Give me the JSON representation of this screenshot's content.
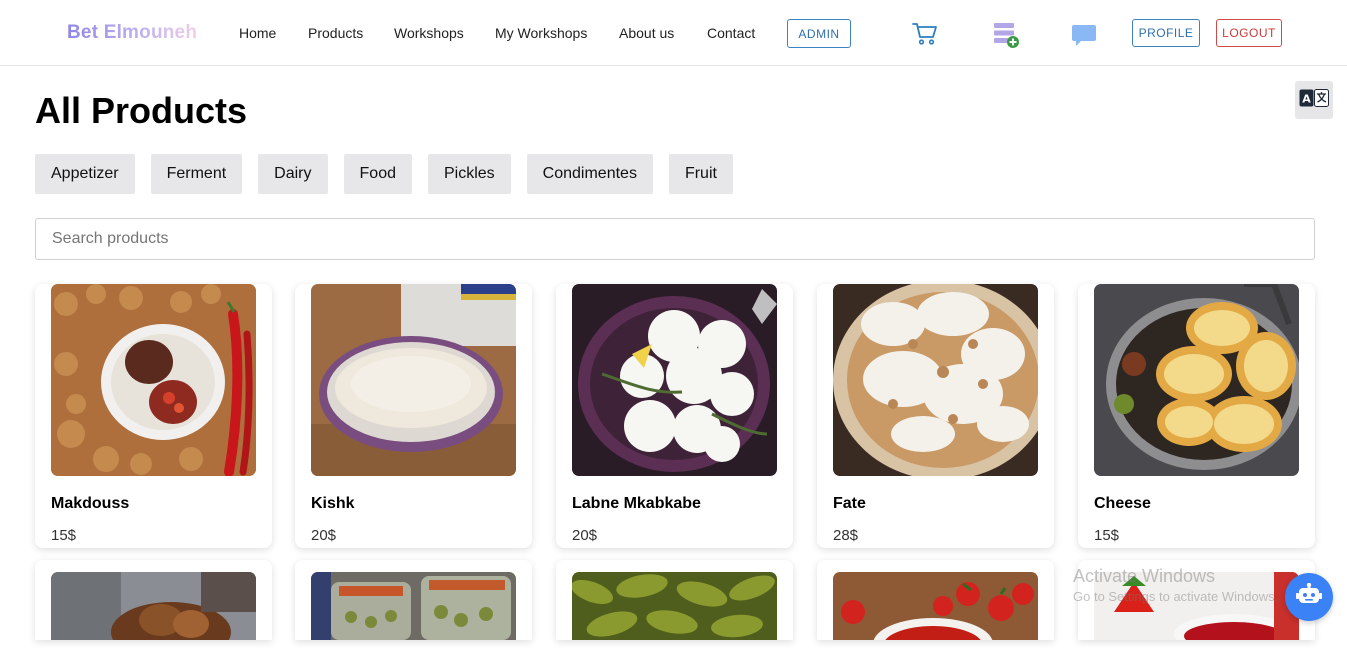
{
  "app": {
    "brand": "Bet Elmouneh"
  },
  "nav": {
    "home": "Home",
    "products": "Products",
    "workshops": "Workshops",
    "my_workshops": "My Workshops",
    "about": "About us",
    "contact": "Contact",
    "admin": "ADMIN",
    "profile": "PROFILE",
    "logout": "LOGOUT"
  },
  "icons": {
    "cart": "cart-icon",
    "add_list": "add-list-icon",
    "chat": "chat-bubble-icon",
    "translate": "translate-icon",
    "chatbot": "chatbot-icon"
  },
  "colors": {
    "accent_blue": "#3f82c0",
    "logout_red": "#d04a4a",
    "category_bg": "#e7e7ea",
    "chatbot_blue": "#3b82f6"
  },
  "page": {
    "title": "All Products"
  },
  "categories": [
    "Appetizer",
    "Ferment",
    "Dairy",
    "Food",
    "Pickles",
    "Condimentes",
    "Fruit"
  ],
  "search": {
    "placeholder": "Search products",
    "value": ""
  },
  "products": [
    {
      "name": "Makdouss",
      "price": "15$"
    },
    {
      "name": "Kishk",
      "price": "20$"
    },
    {
      "name": "Labne Mkabkabe",
      "price": "20$"
    },
    {
      "name": "Fate",
      "price": "28$"
    },
    {
      "name": "Cheese",
      "price": "15$"
    }
  ],
  "watermark": {
    "line1": "Activate Windows",
    "line2": "Go to Settings to activate Windows."
  }
}
